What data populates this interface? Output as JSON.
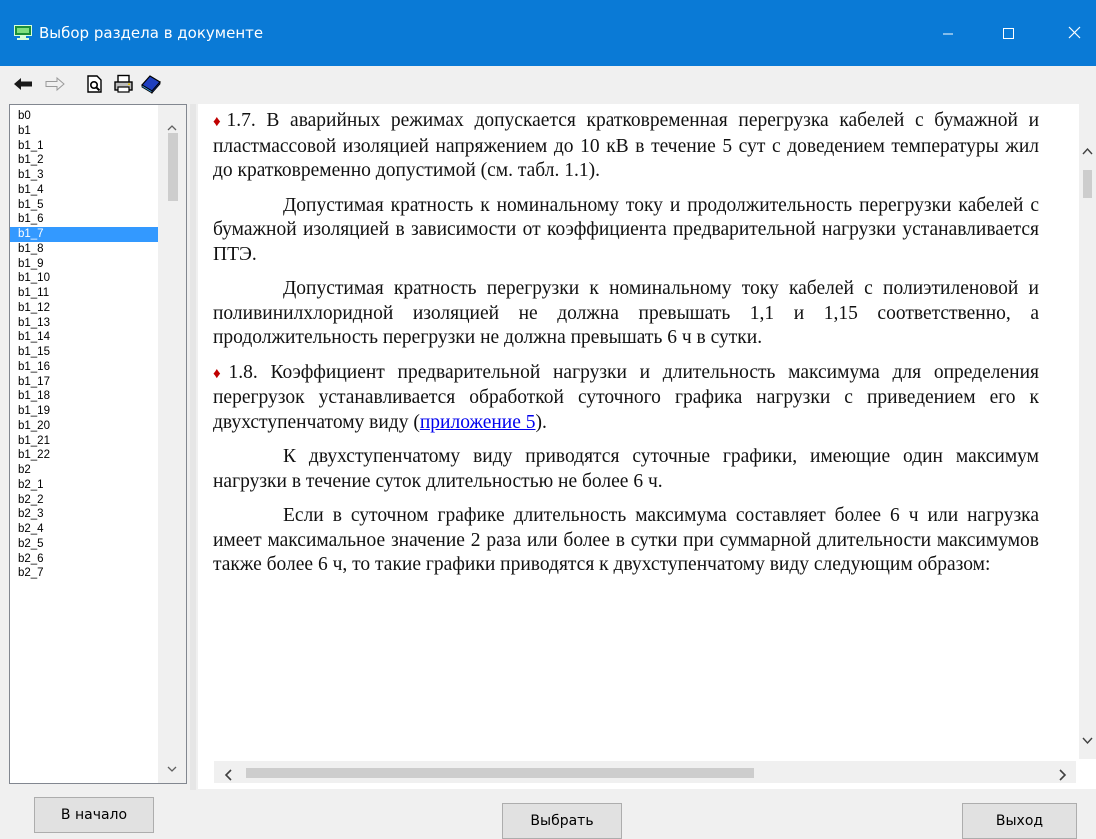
{
  "window": {
    "title": "Выбор раздела в документе",
    "accent_color": "#0a7ad6"
  },
  "toolbar": {
    "icons": [
      "back-arrow-icon",
      "forward-arrow-icon",
      "preview-icon",
      "print-icon",
      "book-icon"
    ]
  },
  "sections": {
    "selected": "b1_7",
    "items": [
      "b0",
      "b1",
      "b1_1",
      "b1_2",
      "b1_3",
      "b1_4",
      "b1_5",
      "b1_6",
      "b1_7",
      "b1_8",
      "b1_9",
      "b1_10",
      "b1_11",
      "b1_12",
      "b1_13",
      "b1_14",
      "b1_15",
      "b1_16",
      "b1_17",
      "b1_18",
      "b1_19",
      "b1_20",
      "b1_21",
      "b1_22",
      "b2",
      "b2_1",
      "b2_2",
      "b2_3",
      "b2_4",
      "b2_5",
      "b2_6",
      "b2_7"
    ]
  },
  "content": {
    "p1_num": "1.7.",
    "p1_text": " В аварийных режимах допускается кратковременная перегрузка кабелей с бумажной и пластмассовой изоляцией напряжением до 10 кВ в течение 5 сут с доведением температуры жил до кратковременно допустимой (см. табл. 1.1).",
    "p2": "Допустимая кратность к номинальному току и продолжительность перегрузки кабелей с бумажной изоляцией в зависимости от коэффициента предварительной нагрузки устанавливается ПТЭ.",
    "p3": "Допустимая кратность перегрузки к номинальному току кабелей с полиэтиленовой и поливинилхлоридной изоляцией не должна превышать 1,1 и 1,15 соответственно, а продолжительность перегрузки не должна превышать 6 ч в сутки.",
    "p4_num": "1.8.",
    "p4_text": " Коэффициент предварительной нагрузки и длительность максимума для определения перегрузок устанавливается обработкой суточного графика нагрузки с приведением его к двухступенчатому виду (",
    "p4_link": "приложение 5",
    "p4_end": ").",
    "p5": "К двухступенчатому виду приводятся суточные графики, имеющие один максимум нагрузки в течение суток длительностью не более 6 ч.",
    "p6": "Если в суточном графике длительность максимума составляет более 6 ч или нагрузка имеет максимальное значение 2 раза или более в сутки при суммарной длительности максимумов также более 6 ч, то такие графики приводятся к двухступенчатому виду следующим образом:",
    "diamond_color": "#c00000"
  },
  "buttons": {
    "begin": "В начало",
    "choose": "Выбрать",
    "exit": "Выход"
  }
}
